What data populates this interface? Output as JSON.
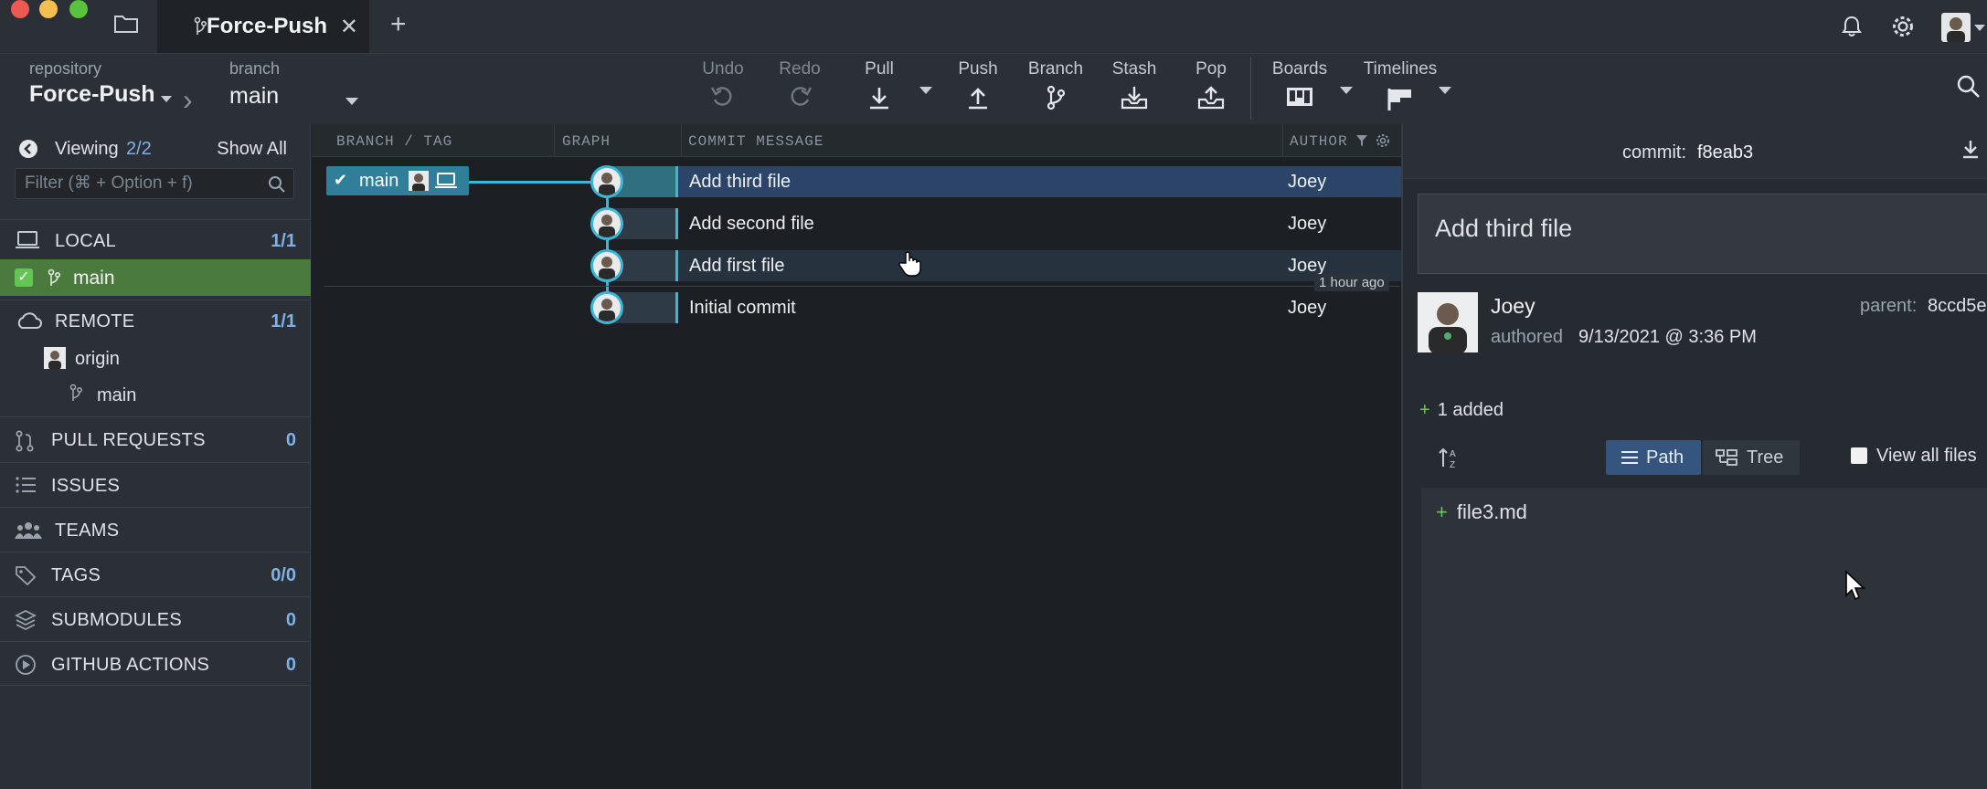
{
  "tab": {
    "title": "Force-Push",
    "close": "✕",
    "add": "+"
  },
  "toolbar": {
    "repo_label": "repository",
    "repo_value": "Force-Push",
    "branch_label": "branch",
    "branch_value": "main",
    "tools": {
      "undo": "Undo",
      "redo": "Redo",
      "pull": "Pull",
      "push": "Push",
      "branch": "Branch",
      "stash": "Stash",
      "pop": "Pop",
      "boards": "Boards",
      "timelines": "Timelines"
    }
  },
  "sidebar": {
    "viewing_label": "Viewing",
    "viewing_count": "2/2",
    "show_all": "Show All",
    "filter_placeholder": "Filter (⌘ + Option + f)",
    "local": {
      "label": "LOCAL",
      "count": "1/1",
      "branch": "main"
    },
    "remote": {
      "label": "REMOTE",
      "count": "1/1",
      "origin": "origin",
      "branch": "main"
    },
    "pull_requests": {
      "label": "PULL REQUESTS",
      "count": "0"
    },
    "issues": {
      "label": "ISSUES"
    },
    "teams": {
      "label": "TEAMS"
    },
    "tags": {
      "label": "TAGS",
      "count": "0/0"
    },
    "submodules": {
      "label": "SUBMODULES",
      "count": "0"
    },
    "github_actions": {
      "label": "GITHUB ACTIONS",
      "count": "0"
    }
  },
  "graph": {
    "headers": {
      "branch_tag": "BRANCH / TAG",
      "graph": "GRAPH",
      "commit_message": "COMMIT MESSAGE",
      "author": "AUTHOR"
    },
    "branch_pill": "main",
    "time_badge": "1 hour ago",
    "commits": [
      {
        "message": "Add third file",
        "author": "Joey"
      },
      {
        "message": "Add second file",
        "author": "Joey"
      },
      {
        "message": "Add first file",
        "author": "Joey"
      },
      {
        "message": "Initial commit",
        "author": "Joey"
      }
    ]
  },
  "detail": {
    "commit_label": "commit:",
    "commit_sha": "f8eab3",
    "message": "Add third file",
    "author": "Joey",
    "authored_label": "authored",
    "date": "9/13/2021 @ 3:36 PM",
    "parent_label": "parent:",
    "parent_sha": "8ccd5e",
    "added": "1 added",
    "path_label": "Path",
    "tree_label": "Tree",
    "view_all": "View all files",
    "files": [
      "file3.md"
    ]
  },
  "colors": {
    "accent": "#3cb6d4",
    "selected_row": "#2c4468",
    "local_branch": "#4b7a3e",
    "count": "#7fb0e6"
  }
}
